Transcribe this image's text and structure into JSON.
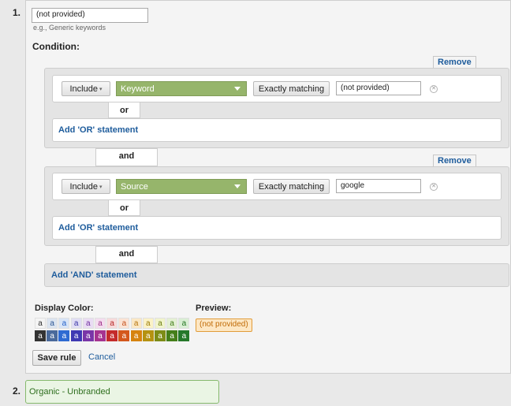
{
  "rule1": {
    "number": "1.",
    "name_value": "(not provided)",
    "hint": "e.g., Generic keywords",
    "condition_label": "Condition:",
    "groups": [
      {
        "remove_label": "Remove",
        "include_label": "Include",
        "dimension": "Keyword",
        "match_type": "Exactly matching",
        "value": "(not provided)",
        "or_label": "or",
        "add_or": "Add 'OR' statement"
      },
      {
        "remove_label": "Remove",
        "include_label": "Include",
        "dimension": "Source",
        "match_type": "Exactly matching",
        "value": "google",
        "or_label": "or",
        "add_or": "Add 'OR' statement"
      }
    ],
    "and_label_1": "and",
    "and_label_2": "and",
    "add_and": "Add 'AND' statement",
    "display_color_label": "Display Color:",
    "preview_label": "Preview:",
    "preview_text": "(not provided)",
    "swatch_letter": "a",
    "swatches_top": [
      {
        "bg": "#f4f4f4",
        "fg": "#333333"
      },
      {
        "bg": "#dbe4f0",
        "fg": "#2b5592"
      },
      {
        "bg": "#d7e4f7",
        "fg": "#2360c8"
      },
      {
        "bg": "#e0ddf4",
        "fg": "#3a35a6"
      },
      {
        "bg": "#e9dcf3",
        "fg": "#6e2c9e"
      },
      {
        "bg": "#f4dcef",
        "fg": "#9b2d84"
      },
      {
        "bg": "#f7dada",
        "fg": "#b42424"
      },
      {
        "bg": "#fbe3d4",
        "fg": "#c4501b"
      },
      {
        "bg": "#fbe8c4",
        "fg": "#b5740e"
      },
      {
        "bg": "#fbf2c6",
        "fg": "#9a7a05"
      },
      {
        "bg": "#f1f4cb",
        "fg": "#6d7c12"
      },
      {
        "bg": "#e4f0d3",
        "fg": "#3d7a14"
      },
      {
        "bg": "#d9eed4",
        "fg": "#237421"
      }
    ],
    "swatches_bottom": [
      {
        "bg": "#333333",
        "fg": "#ffffff"
      },
      {
        "bg": "#4a6a9b",
        "fg": "#ffffff"
      },
      {
        "bg": "#2f6bd2",
        "fg": "#ffffff"
      },
      {
        "bg": "#3f39b3",
        "fg": "#ffffff"
      },
      {
        "bg": "#7a36a8",
        "fg": "#ffffff"
      },
      {
        "bg": "#a63490",
        "fg": "#ffffff"
      },
      {
        "bg": "#c42b2b",
        "fg": "#ffffff"
      },
      {
        "bg": "#d4581d",
        "fg": "#ffffff"
      },
      {
        "bg": "#d6830f",
        "fg": "#ffffff"
      },
      {
        "bg": "#b59211",
        "fg": "#ffffff"
      },
      {
        "bg": "#7d8c17",
        "fg": "#ffffff"
      },
      {
        "bg": "#457f1a",
        "fg": "#ffffff"
      },
      {
        "bg": "#25782a",
        "fg": "#ffffff"
      }
    ],
    "save_label": "Save rule",
    "cancel_label": "Cancel"
  },
  "rule2": {
    "number": "2.",
    "name": "Organic - Unbranded"
  }
}
